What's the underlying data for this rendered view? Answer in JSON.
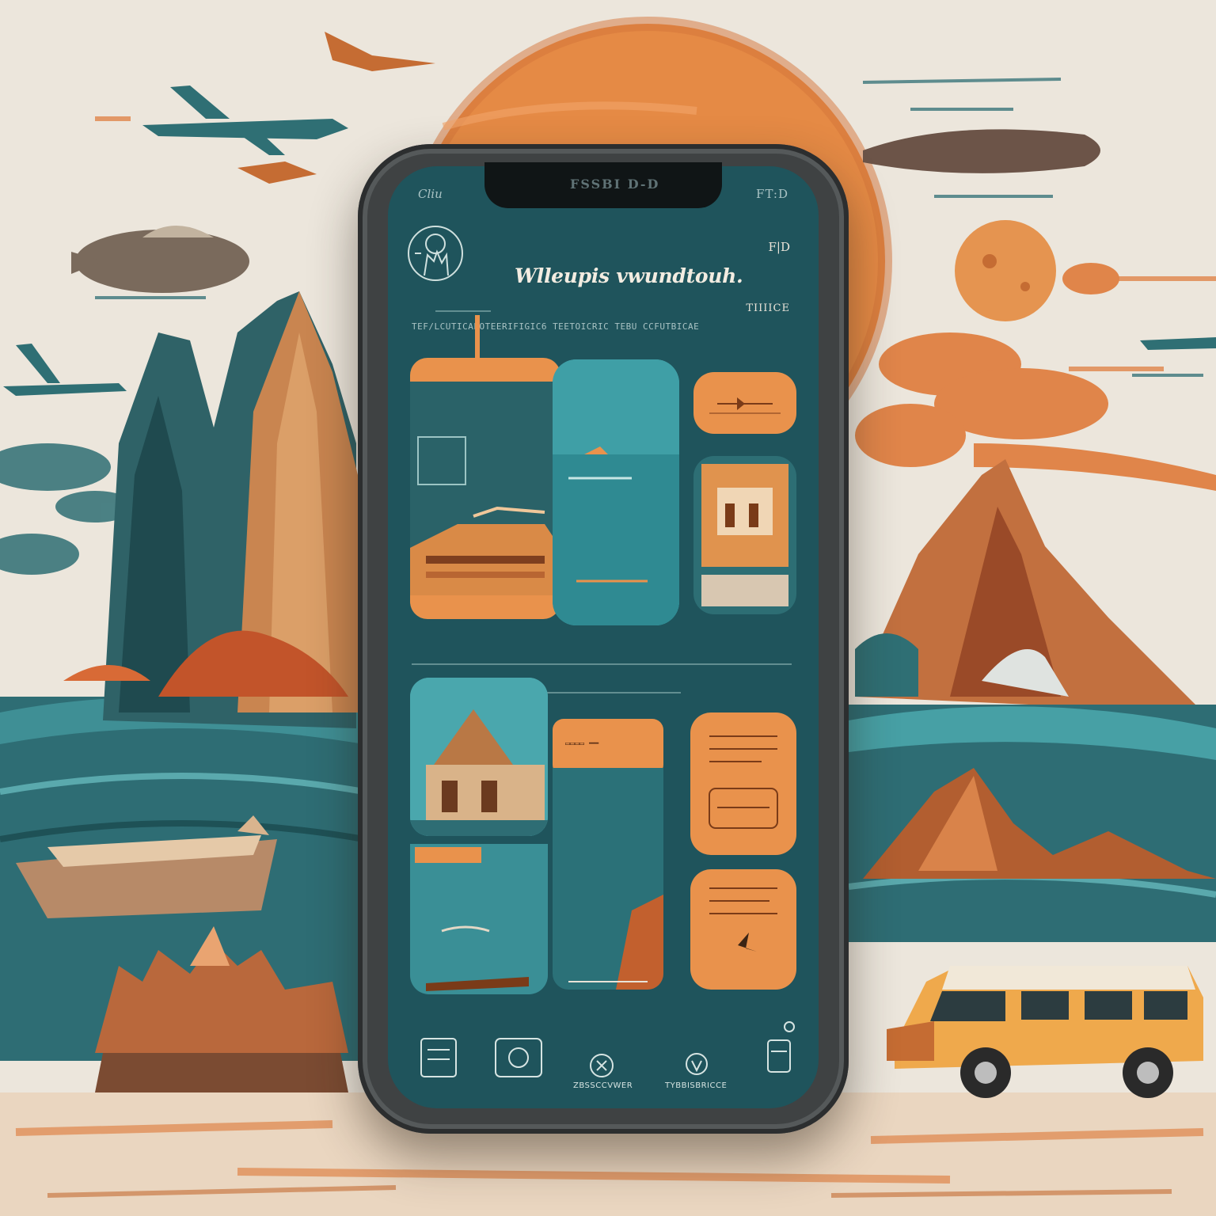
{
  "status_bar": {
    "carrier": "Cliu",
    "notch_label": "FSSBI D-D",
    "clock": "FT:D"
  },
  "header": {
    "title": "Wlleupis vwundtouh.",
    "side_code": "F|D",
    "side_code_sub": "TIIIICE",
    "subline": "TEF/LCUTICAPOTEERIFIGIC6 TEETOICRIC TEBU  CCFUTBICAE"
  },
  "tabs": [
    {
      "label": "ZBSSCCVWER"
    },
    {
      "label": "TYBBISBRICCE"
    }
  ],
  "colors": {
    "screen": "#1f545c",
    "accent": "#e9924c",
    "teal": "#3f9fa6",
    "frame": "#3f4243"
  },
  "icons": [
    "compass-logo-icon",
    "card-list-icon",
    "camera-icon",
    "globe-icon",
    "location-icon",
    "grid-icon"
  ]
}
